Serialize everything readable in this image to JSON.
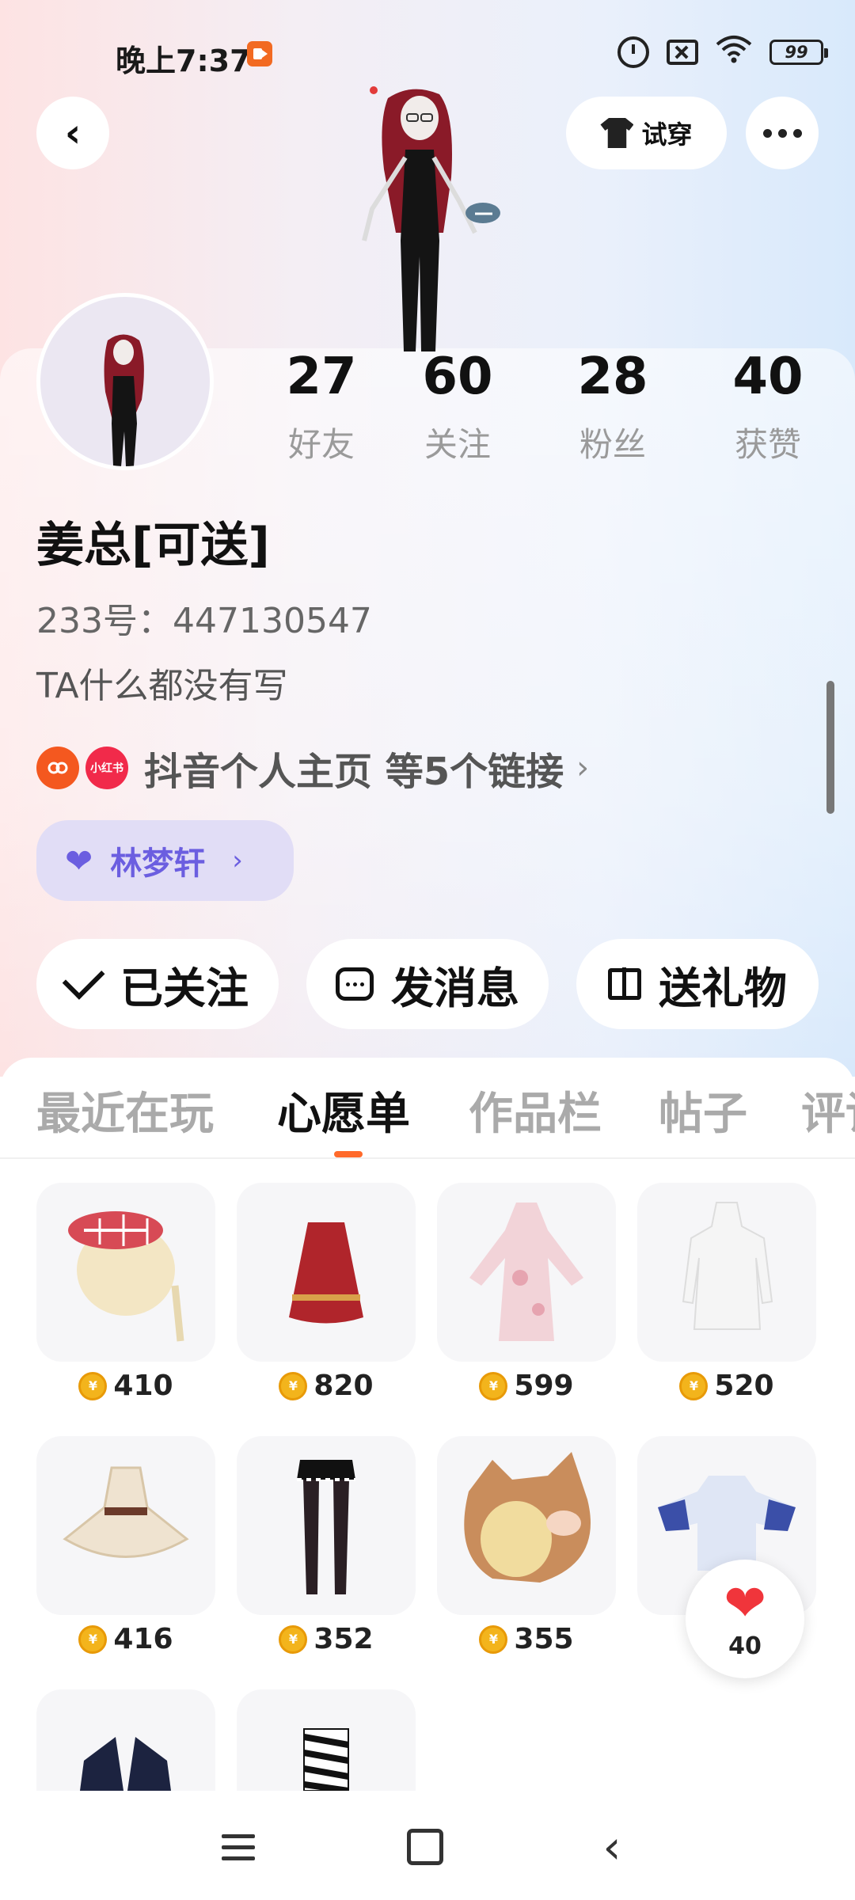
{
  "status_bar": {
    "time": "晚上7:37",
    "battery": "99"
  },
  "header": {
    "back_label": "‹",
    "tryon_label": "试穿"
  },
  "stats": [
    {
      "value": "27",
      "label": "好友"
    },
    {
      "value": "60",
      "label": "关注"
    },
    {
      "value": "28",
      "label": "粉丝"
    },
    {
      "value": "40",
      "label": "获赞"
    }
  ],
  "profile": {
    "name": "姜总[可送]",
    "uid": "233号：447130547",
    "bio": "TA什么都没有写",
    "xhs_badge": "小红书",
    "links_text": "抖音个人主页 等5个链接",
    "relation_name": "林梦轩"
  },
  "actions": {
    "follow": "已关注",
    "message": "发消息",
    "gift": "送礼物"
  },
  "tabs": [
    "最近在玩",
    "心愿单",
    "作品栏",
    "帖子",
    "评论"
  ],
  "active_tab": "心愿单",
  "wishlist": [
    {
      "name": "hat-hair",
      "price": "410"
    },
    {
      "name": "red-skirt",
      "price": "820"
    },
    {
      "name": "pink-qipao",
      "price": "599"
    },
    {
      "name": "white-dress",
      "price": "520"
    },
    {
      "name": "cream-dress",
      "price": "416"
    },
    {
      "name": "black-leggings",
      "price": "352"
    },
    {
      "name": "cat-hood",
      "price": "355"
    },
    {
      "name": "blue-jacket",
      "price": ""
    },
    {
      "name": "black-boots",
      "price": ""
    },
    {
      "name": "zebra-socks",
      "price": ""
    }
  ],
  "like_float": {
    "count": "40"
  },
  "colors": {
    "accent": "#ff6a2b",
    "relation": "#6b5ee0",
    "heart": "#f0353b",
    "coin": "#f3b41c"
  }
}
